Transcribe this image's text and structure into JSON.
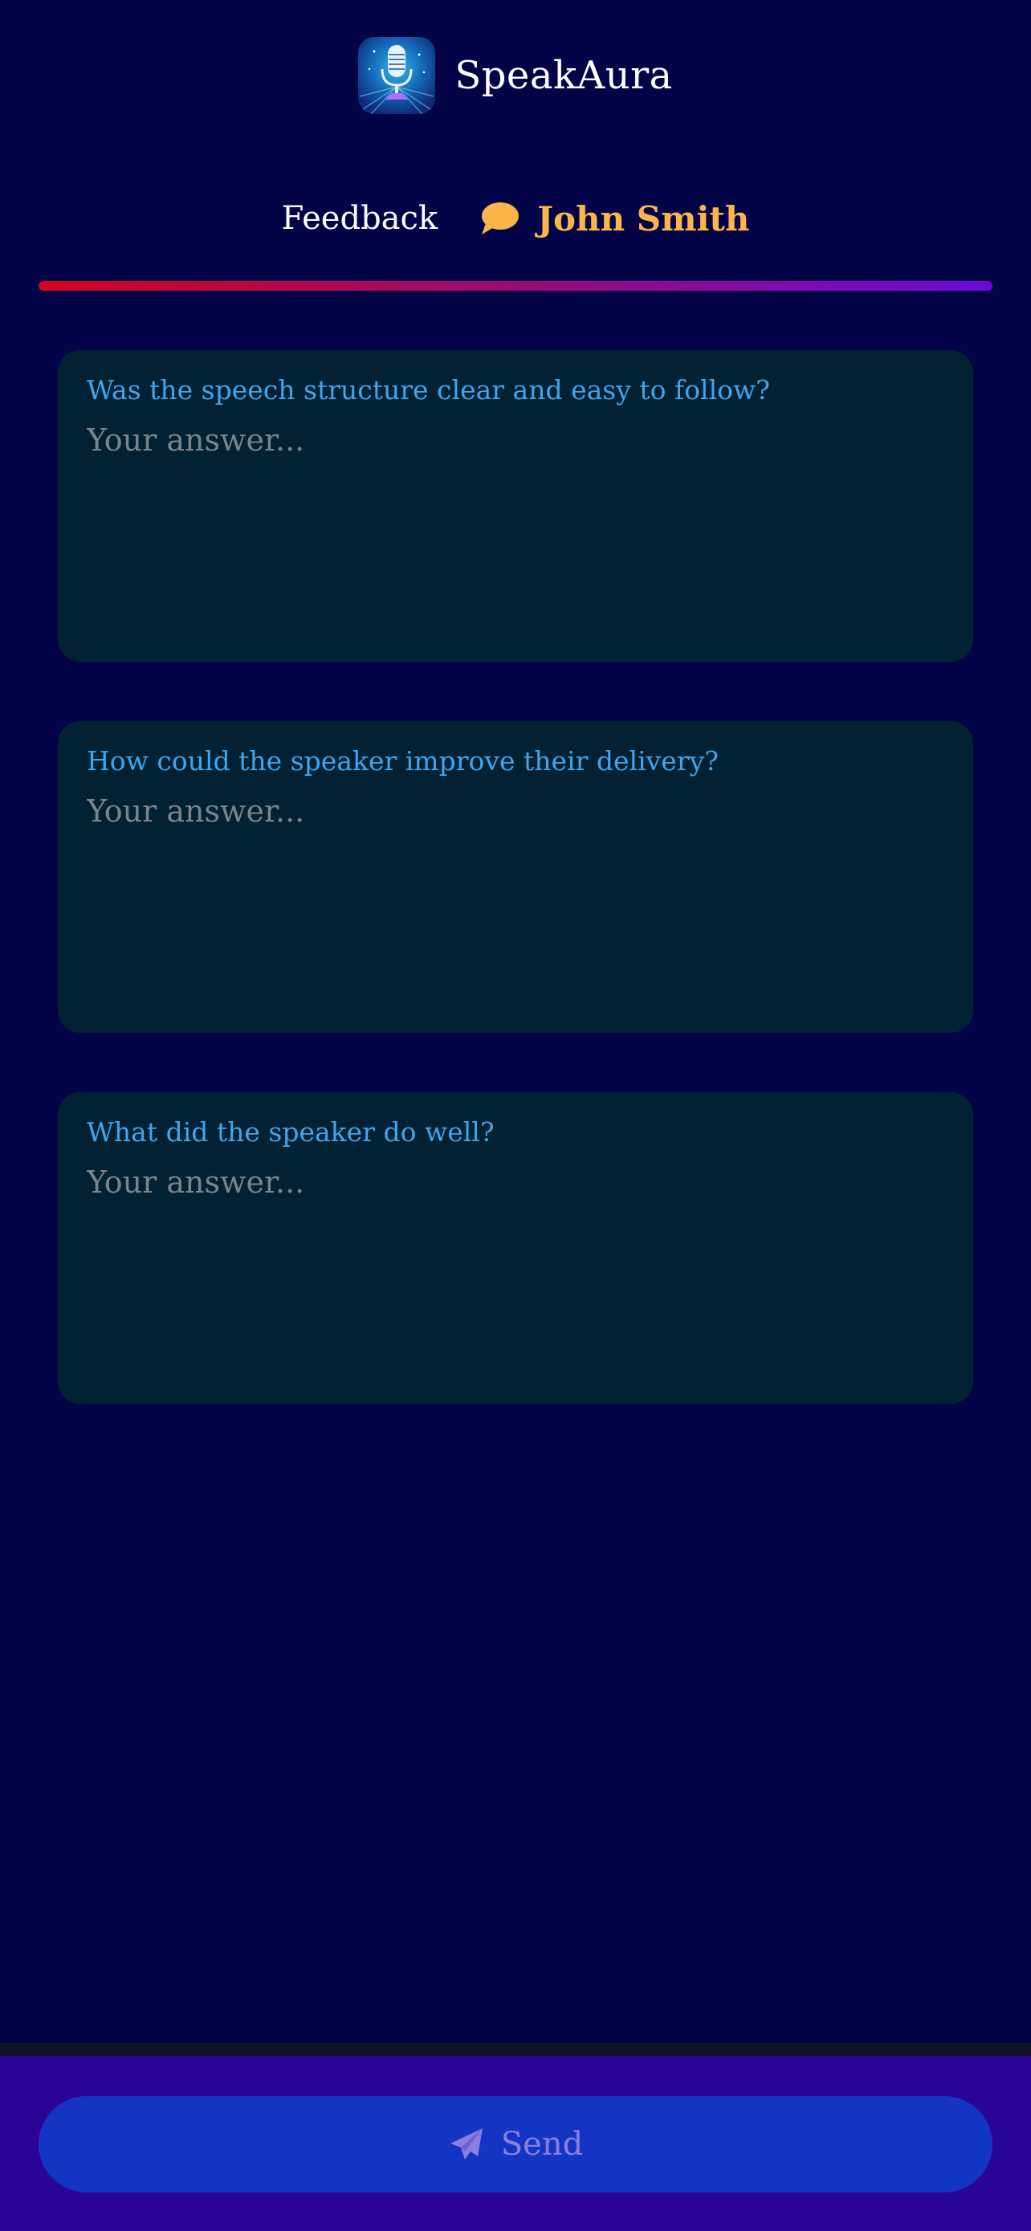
{
  "app": {
    "title": "SpeakAura",
    "logo_icon": "microphone-icon"
  },
  "subheader": {
    "label": "Feedback",
    "icon": "chat-bubble-icon",
    "user_name": "John Smith"
  },
  "questions": [
    {
      "question": "Was the speech structure clear and easy to follow?",
      "placeholder": "Your answer...",
      "value": ""
    },
    {
      "question": "How could the speaker improve their delivery?",
      "placeholder": "Your answer...",
      "value": ""
    },
    {
      "question": "What did the speaker do well?",
      "placeholder": "Your answer...",
      "value": ""
    }
  ],
  "footer": {
    "send_label": "Send",
    "send_icon": "paper-plane-icon"
  },
  "colors": {
    "background": "#020447",
    "card": "#022132",
    "question_text": "#3ea6f0",
    "user_name": "#fbb54a",
    "send_button": "#1434c4",
    "footer": "#2a0595"
  }
}
